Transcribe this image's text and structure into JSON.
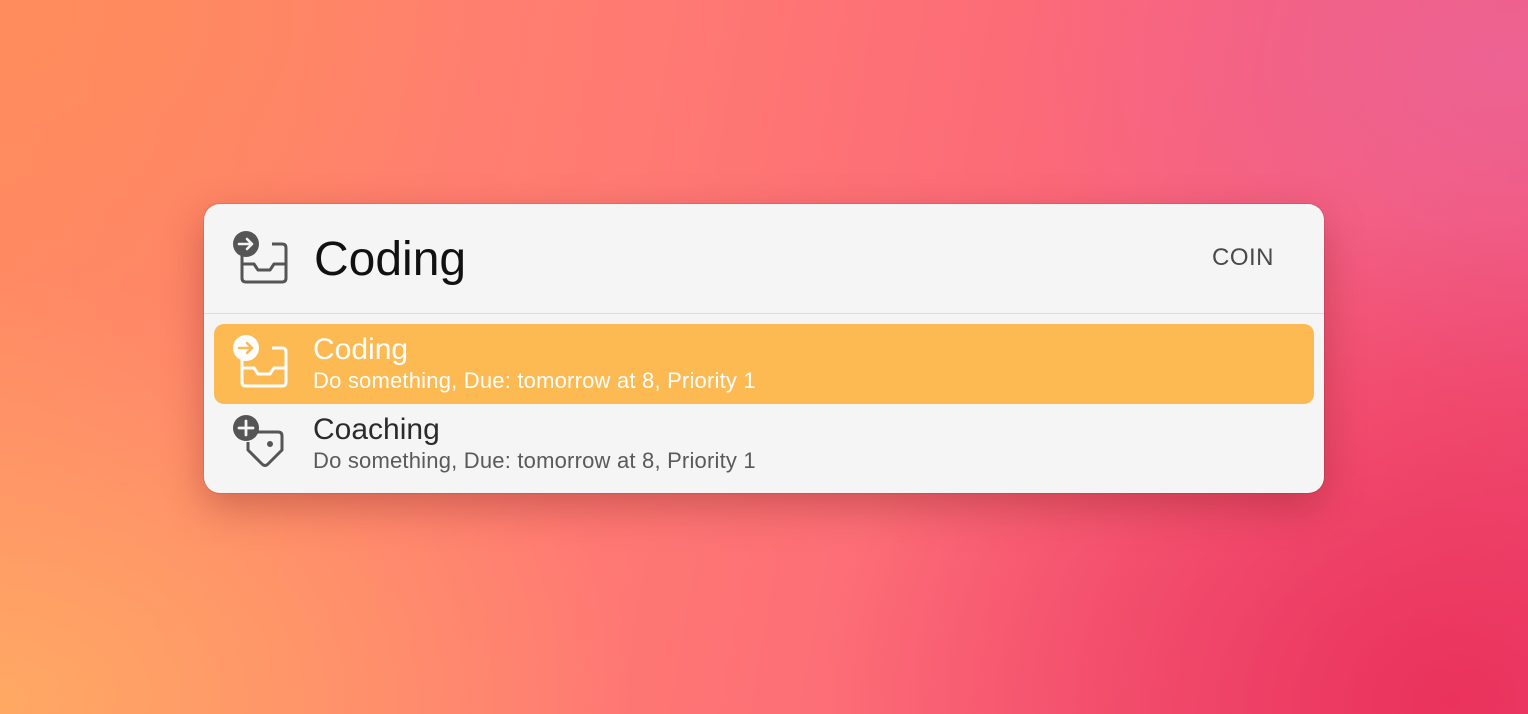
{
  "launcher": {
    "query": "Coding",
    "hotkey_label": "COIN",
    "query_icon": "inbox-arrow-icon"
  },
  "results": [
    {
      "title": "Coding",
      "subtitle": "Do something, Due: tomorrow at 8, Priority 1",
      "icon": "inbox-arrow-icon",
      "selected": true
    },
    {
      "title": "Coaching",
      "subtitle": "Do something, Due: tomorrow at 8, Priority 1",
      "icon": "tag-plus-icon",
      "selected": false
    }
  ],
  "colors": {
    "selection": "#fdba52",
    "panel_background": "#f5f5f5"
  }
}
